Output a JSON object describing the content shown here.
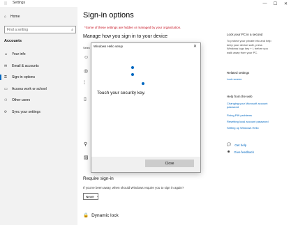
{
  "window": {
    "title": "Settings",
    "minimize": "—",
    "maximize": "☐",
    "close": "✕"
  },
  "sidebar": {
    "home_label": "Home",
    "search_placeholder": "Find a setting",
    "section_title": "Accounts",
    "items": [
      {
        "label": "Your info",
        "icon": "person-card-icon",
        "glyph": "☺"
      },
      {
        "label": "Email & accounts",
        "icon": "email-icon",
        "glyph": "✉"
      },
      {
        "label": "Sign-in options",
        "icon": "key-icon",
        "glyph": "⚿"
      },
      {
        "label": "Access work or school",
        "icon": "briefcase-icon",
        "glyph": "▭"
      },
      {
        "label": "Other users",
        "icon": "people-icon",
        "glyph": "⚇"
      },
      {
        "label": "Sync your settings",
        "icon": "sync-icon",
        "glyph": "⟳"
      }
    ]
  },
  "main": {
    "page_title": "Sign-in options",
    "warning": "*Some of these settings are hidden or managed by your organization.",
    "manage_heading": "Manage how you sign in to your device",
    "select_label": "Selec",
    "require_heading": "Require sign-in",
    "require_question": "If you've been away, when should Windows require you to sign in again?",
    "never_value": "Never",
    "dynamic_heading": "Dynamic lock"
  },
  "right_panel": {
    "lock_title": "Lock your PC in a second",
    "lock_body": "To protect your private info and help keep your device safe, press Windows logo key + L before you walk away from your PC.",
    "related_title": "Related settings",
    "related_links": [
      "Lock screen"
    ],
    "help_title": "Help from the web",
    "help_links": [
      "Changing your Microsoft account password",
      "Fixing PIN problems",
      "Resetting local account password",
      "Setting up Windows Hello"
    ],
    "get_help": "Get help",
    "give_feedback": "Give feedback"
  },
  "dialog": {
    "title": "Windows Hello setup",
    "message": "Touch your security key.",
    "close_button": "Close",
    "close_glyph": "✕"
  },
  "colors": {
    "accent": "#0067c0",
    "warning": "#c50f1f",
    "sidebar_bg": "#f2f2f2"
  }
}
